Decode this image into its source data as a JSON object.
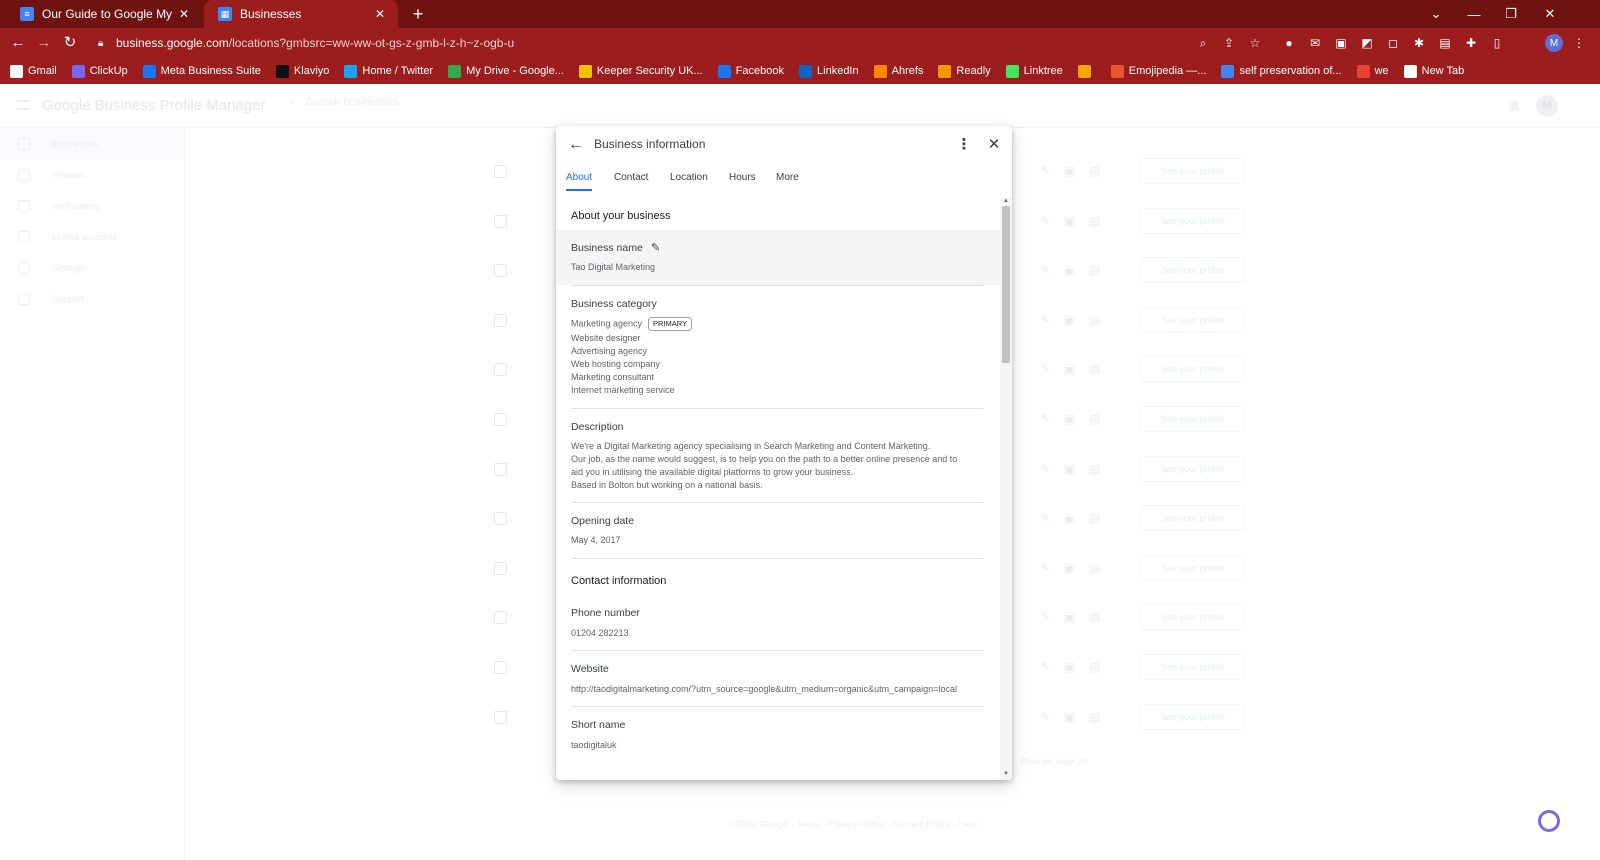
{
  "browser": {
    "tabs": [
      {
        "title": "Our Guide to Google My Busines",
        "active": false
      },
      {
        "title": "Businesses",
        "active": true
      }
    ],
    "tab_close": "✕",
    "new_tab": "+",
    "window": {
      "minimize": "—",
      "restore": "❐",
      "close": "✕",
      "dropdown": "⌄"
    },
    "url_host": "business.google.com",
    "url_path": "/locations?gmbsrc=ww-ww-ot-gs-z-gmb-l-z-h~z-ogb-u",
    "profile_initial": "M",
    "bookmarks": [
      {
        "label": "Gmail",
        "color": "#ffffff"
      },
      {
        "label": "ClickUp",
        "color": "#7b68ee"
      },
      {
        "label": "Meta Business Suite",
        "color": "#1877f2"
      },
      {
        "label": "Klaviyo",
        "color": "#111111"
      },
      {
        "label": "Home / Twitter",
        "color": "#1da1f2"
      },
      {
        "label": "My Drive - Google...",
        "color": "#34a853"
      },
      {
        "label": "Keeper Security UK...",
        "color": "#f2c200"
      },
      {
        "label": "Facebook",
        "color": "#1877f2"
      },
      {
        "label": "LinkedIn",
        "color": "#0a66c2"
      },
      {
        "label": "Ahrefs",
        "color": "#ff8800"
      },
      {
        "label": "Readly",
        "color": "#f29900"
      },
      {
        "label": "Linktree",
        "color": "#43e55e"
      },
      {
        "label": "",
        "color": "#f7a600"
      },
      {
        "label": "Emojipedia —...",
        "color": "#e8572b"
      },
      {
        "label": "self preservation of...",
        "color": "#4285f4"
      },
      {
        "label": "we",
        "color": "#ea4335"
      },
      {
        "label": "New Tab",
        "color": "#ffffff"
      }
    ]
  },
  "background_app": {
    "logo": "Google Business Profile Manager",
    "search_placeholder": "Search businesses",
    "account_initial": "M",
    "sidebar": [
      "Businesses",
      "Reviews",
      "Verifications",
      "Linked accounts",
      "Settings",
      "Support"
    ],
    "see_profile": "See your profile",
    "rows_per_page": "Rows per page:   25",
    "footer": "©2022 Google  ·  Terms  ·  Privacy Policy  ·  Content Policy  ·  Help"
  },
  "dialog": {
    "title": "Business information",
    "tabs": [
      "About",
      "Contact",
      "Location",
      "Hours",
      "More"
    ],
    "active_tab": "About",
    "about_section_title": "About your business",
    "business_name_label": "Business name",
    "business_name_value": "Tao Digital Marketing",
    "business_category_label": "Business category",
    "primary_chip": "PRIMARY",
    "categories": [
      "Marketing agency",
      "Website designer",
      "Advertising agency",
      "Web hosting company",
      "Marketing consultant",
      "Internet marketing service"
    ],
    "description_label": "Description",
    "description_lines": [
      "We're a Digital Marketing agency specialising in Search Marketing and Content Marketing.",
      "Our job, as the name would suggest, is to help you on the path to a better online presence and to",
      "aid you in utilising the available digital platforms to grow your business.",
      "Based in Bolton but working on a national basis."
    ],
    "opening_date_label": "Opening date",
    "opening_date_value": "May 4, 2017",
    "contact_section_title": "Contact information",
    "phone_label": "Phone number",
    "phone_value": "01204 282213",
    "website_label": "Website",
    "website_value": "http://taodigitalmarketing.com/?utm_source=google&utm_medium=organic&utm_campaign=local",
    "short_name_label": "Short name",
    "short_name_value": "taodigitaluk"
  },
  "colors": {
    "chrome_dark": "#6f1212",
    "chrome": "#9c1d1d",
    "accent": "#1a73e8"
  }
}
